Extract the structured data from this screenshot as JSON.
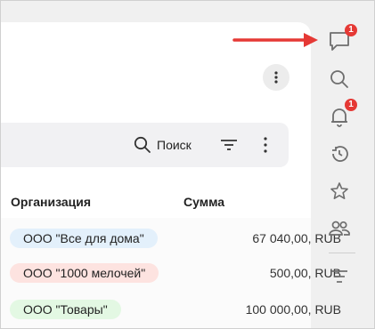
{
  "toolbar": {
    "search_label": "Поиск"
  },
  "table": {
    "columns": [
      "Организация",
      "Сумма"
    ],
    "rows": [
      {
        "organization": "ООО \"Все для дома\"",
        "amount": "67 040,00, RUB",
        "chip_color": "#e3f0fb"
      },
      {
        "organization": "ООО \"1000 мелочей\"",
        "amount": "500,00, RUB",
        "chip_color": "#fde3e0"
      },
      {
        "organization": "ООО \"Товары\"",
        "amount": "100 000,00, RUB",
        "chip_color": "#e3f8e3"
      }
    ]
  },
  "rail": {
    "chat_badge": "1",
    "notifications_badge": "1",
    "items": [
      "chat-icon",
      "search-icon",
      "bell-icon",
      "history-icon",
      "star-icon",
      "people-icon",
      "menu-icon"
    ]
  },
  "colors": {
    "badge": "#e53935",
    "arrow": "#e53935",
    "icon": "#6e6e6e"
  }
}
